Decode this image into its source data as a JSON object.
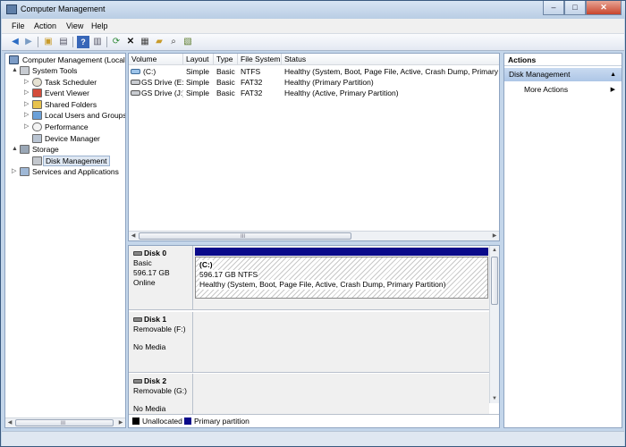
{
  "window": {
    "title": "Computer Management",
    "minimize": "–",
    "maximize": "□",
    "close": "✕"
  },
  "menu": [
    "File",
    "Action",
    "View",
    "Help"
  ],
  "toolbar": {
    "icons": [
      "back-arrow-icon",
      "forward-arrow-icon",
      "up-folder-icon",
      "show-hide-tree-icon",
      "help-icon",
      "show-hide-action-pane-icon",
      "refresh-icon",
      "delete-icon",
      "properties-icon",
      "open-icon",
      "search-icon",
      "export-icon"
    ]
  },
  "tree": {
    "items": [
      {
        "label": "Computer Management (Local",
        "expander": ""
      },
      {
        "label": "System Tools",
        "expander": "▲"
      },
      {
        "label": "Task Scheduler",
        "expander": "▷"
      },
      {
        "label": "Event Viewer",
        "expander": "▷"
      },
      {
        "label": "Shared Folders",
        "expander": "▷"
      },
      {
        "label": "Local Users and Groups",
        "expander": "▷"
      },
      {
        "label": "Performance",
        "expander": "▷"
      },
      {
        "label": "Device Manager",
        "expander": ""
      },
      {
        "label": "Storage",
        "expander": "▲"
      },
      {
        "label": "Disk Management",
        "expander": ""
      },
      {
        "label": "Services and Applications",
        "expander": "▷"
      }
    ],
    "scroll_grip": "III"
  },
  "volumes": {
    "columns": [
      "Volume",
      "Layout",
      "Type",
      "File System",
      "Status"
    ],
    "rows": [
      {
        "volume": "(C:)",
        "layout": "Simple",
        "type": "Basic",
        "fs": "NTFS",
        "status": "Healthy (System, Boot, Page File, Active, Crash Dump, Primary Pa"
      },
      {
        "volume": "GS Drive (E:)",
        "layout": "Simple",
        "type": "Basic",
        "fs": "FAT32",
        "status": "Healthy (Primary Partition)"
      },
      {
        "volume": "GS Drive (J:)",
        "layout": "Simple",
        "type": "Basic",
        "fs": "FAT32",
        "status": "Healthy (Active, Primary Partition)"
      }
    ],
    "scroll_grip": "III"
  },
  "disks": [
    {
      "name": "Disk 0",
      "line1": "Basic",
      "line2": "596.17 GB",
      "line3": "Online",
      "partition": {
        "title": "(C:)",
        "size": "596.17 GB NTFS",
        "status": "Healthy (System, Boot, Page File, Active, Crash Dump, Primary Partition)"
      }
    },
    {
      "name": "Disk 1",
      "line1": "Removable (F:)",
      "line2": "",
      "line3": "No Media"
    },
    {
      "name": "Disk 2",
      "line1": "Removable (G:)",
      "line2": "",
      "line3": "No Media"
    }
  ],
  "legend": {
    "unallocated": "Unallocated",
    "primary": "Primary partition"
  },
  "colors": {
    "unallocated": "#000000",
    "primary": "#0a0a8a",
    "selection": "#dfe8f3",
    "action_header": "#b8cde9"
  },
  "actions": {
    "title": "Actions",
    "section": "Disk Management",
    "more": "More Actions"
  }
}
